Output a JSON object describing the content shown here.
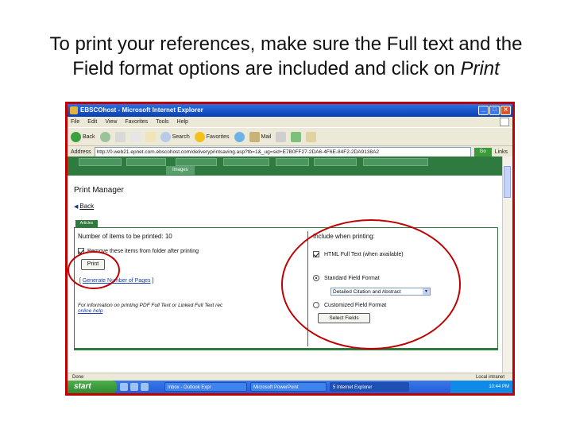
{
  "slide": {
    "title_line1": "To print your references, make sure the Full text and the",
    "title_line2": "Field format options are included and click on ",
    "title_emphasis": "Print"
  },
  "ie": {
    "window_title": "EBSCOhost - Microsoft Internet Explorer",
    "menu": [
      "File",
      "Edit",
      "View",
      "Favorites",
      "Tools",
      "Help"
    ],
    "toolbar": {
      "back": "Back",
      "search": "Search",
      "favorites": "Favorites",
      "mail": "Mail"
    },
    "address_label": "Address",
    "address_value": "http://0.web21.epnet.com.ebscohost.com/deliveryprintsaving.asp?tb=1&_ug=sid+E7B0FF27-2DA6-4F6E-84F2-2DA9138A2",
    "go_label": "Go",
    "links_label": "Links"
  },
  "page": {
    "nav_tab_images": "Images",
    "title": "Print Manager",
    "back_link": "Back",
    "articles_tab": "Articles",
    "num_items": "Number of items to be printed: 10",
    "remove_label": "Remove these items from folder after printing",
    "print_button": "Print",
    "generate_link": "Generate Number of Pages",
    "info_text": "For information on printing PDF Full Text or Linked Full Text rec",
    "info_link": "online help",
    "include_label": "Include when printing:",
    "html_fulltext_label": "HTML Full Text (when available)",
    "standard_format_label": "Standard Field Format",
    "format_select_value": "Detailed Citation and Abstract",
    "customized_format_label": "Customized Field Format",
    "select_fields_button": "Select Fields"
  },
  "status": {
    "text": "Done",
    "zone": "Local intranet"
  },
  "taskbar": {
    "start_label": "start",
    "tasks": [
      "Inbox - Outlook Expr",
      "Microsoft PowerPoint",
      "5 Internet Explorer"
    ],
    "clock": "10:44 PM"
  },
  "colors": {
    "annotation": "#c00000",
    "ebsco_green": "#2f7b3f",
    "link_blue": "#1a3fa8"
  }
}
